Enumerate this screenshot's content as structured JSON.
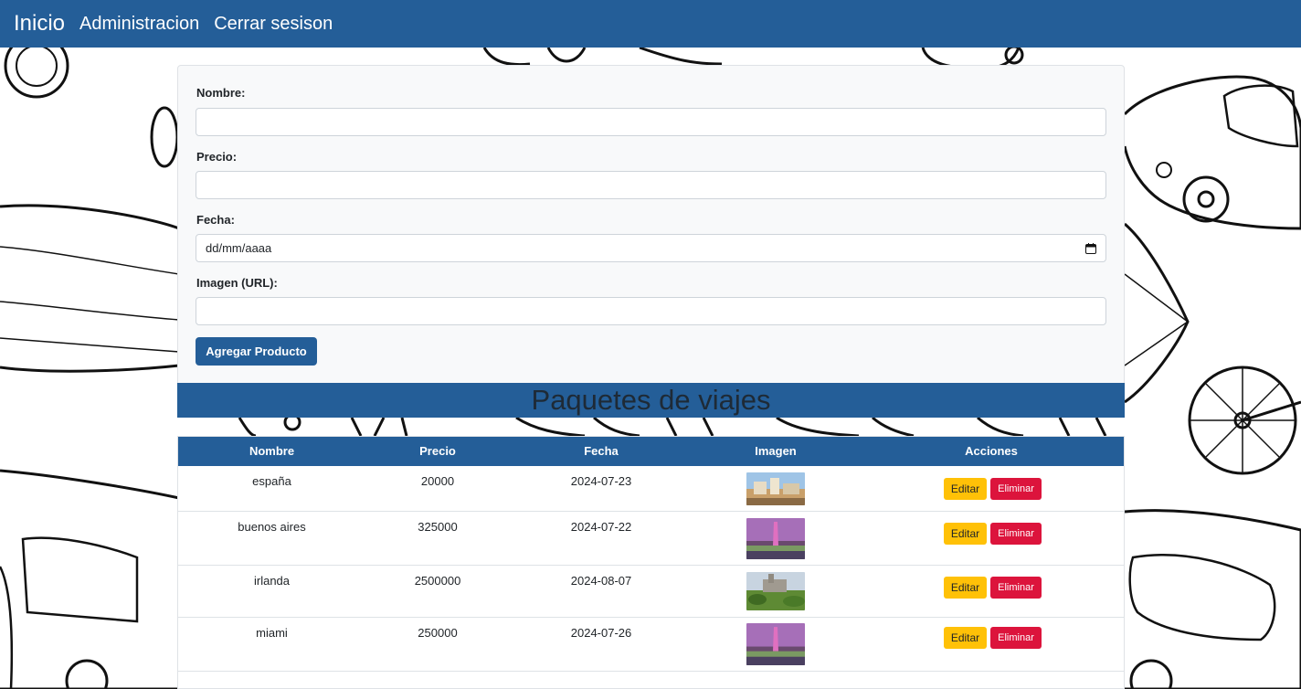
{
  "nav": {
    "brand": "Inicio",
    "links": [
      "Administracion",
      "Cerrar sesison"
    ]
  },
  "form": {
    "nombre_label": "Nombre:",
    "nombre_value": "",
    "precio_label": "Precio:",
    "precio_value": "",
    "fecha_label": "Fecha:",
    "fecha_placeholder": "dd/mm/aaaa",
    "imagen_label": "Imagen (URL):",
    "imagen_value": "",
    "submit_label": "Agregar Producto"
  },
  "section_title": "Paquetes de viajes",
  "table": {
    "headers": [
      "Nombre",
      "Precio",
      "Fecha",
      "Imagen",
      "Acciones"
    ],
    "rows": [
      {
        "nombre": "españa",
        "precio": "20000",
        "fecha": "2024-07-23",
        "imagen": "madrid-thumbnail",
        "edit": "Editar",
        "delete": "Eliminar"
      },
      {
        "nombre": "buenos aires",
        "precio": "325000",
        "fecha": "2024-07-22",
        "imagen": "obelisco-thumbnail",
        "edit": "Editar",
        "delete": "Eliminar"
      },
      {
        "nombre": "irlanda",
        "precio": "2500000",
        "fecha": "2024-08-07",
        "imagen": "castle-thumbnail",
        "edit": "Editar",
        "delete": "Eliminar"
      },
      {
        "nombre": "miami",
        "precio": "250000",
        "fecha": "2024-07-26",
        "imagen": "obelisco-thumbnail",
        "edit": "Editar",
        "delete": "Eliminar"
      }
    ]
  },
  "colors": {
    "primary": "#245e98",
    "edit": "#ffc107",
    "delete": "#dc143c",
    "form_bg": "#f8f9fa"
  },
  "icons": {
    "date": "calendar-icon"
  }
}
